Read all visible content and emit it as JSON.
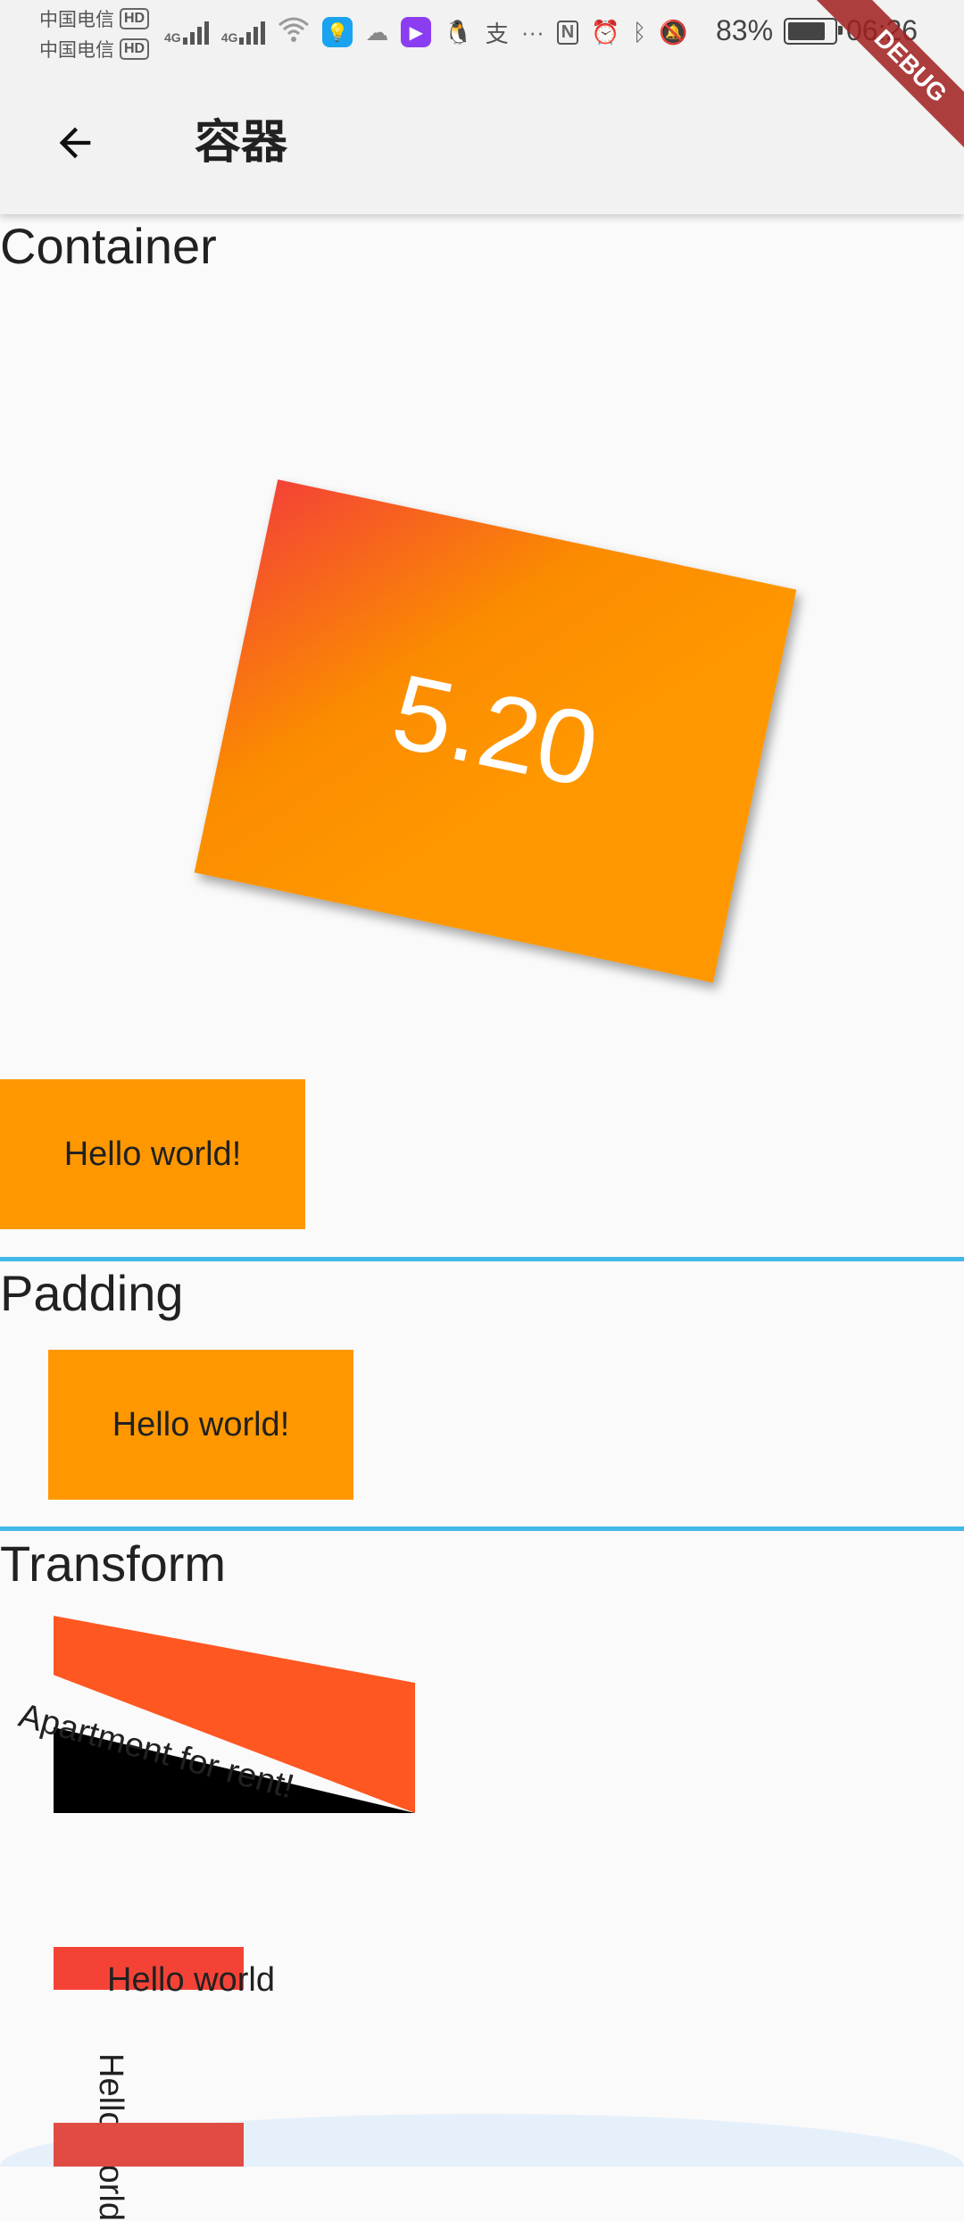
{
  "status_bar": {
    "carrier1": "中国电信",
    "carrier2": "中国电信",
    "hd_badge": "HD",
    "network": "4G",
    "alipay_glyph": "支",
    "more": "···",
    "battery_pct": "83%",
    "battery_level": 0.83,
    "time": "06:26"
  },
  "app_bar": {
    "title": "容器",
    "back_icon": "arrow-back-icon"
  },
  "debug_banner": "DEBUG",
  "sections": {
    "container": {
      "title": "Container",
      "card_value": "5.20",
      "box_label": "Hello world!"
    },
    "padding": {
      "title": "Padding",
      "box_label": "Hello world!"
    },
    "transform": {
      "title": "Transform",
      "skew_label": "Apartment for rent!",
      "hello1": "Hello world",
      "hello_rot": "Hello world"
    }
  },
  "colors": {
    "orange": "#ff9800",
    "deep_orange": "#ff5722",
    "red": "#f44336",
    "divider": "#42b8e8"
  }
}
